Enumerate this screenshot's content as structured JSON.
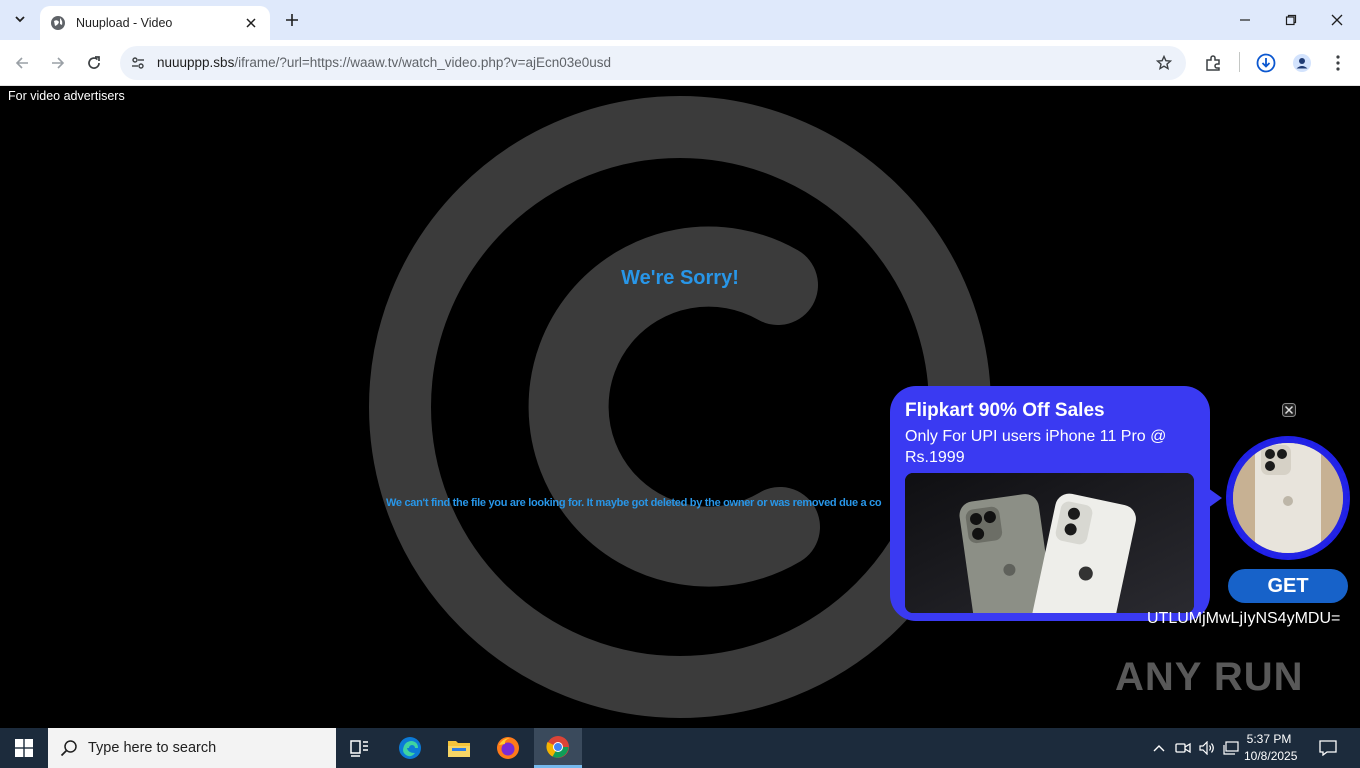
{
  "browser": {
    "tab_title": "Nuupload - Video",
    "url_host": "nuuuppp.sbs",
    "url_path": "/iframe/?url=https://waaw.tv/watch_video.php?v=ajEcn03e0usd"
  },
  "page": {
    "advertisers_link": "For video advertisers",
    "sorry_title": "We're Sorry!",
    "sorry_text": "We can't find the file you are looking for. It maybe got deleted by the owner or was removed due a co"
  },
  "ad": {
    "headline": "Flipkart 90% Off Sales",
    "subline": "Only For UPI users iPhone 11 Pro @ Rs.1999",
    "cta": "GET",
    "token": "UTLUMjMwLjIyNS4yMDU=",
    "watermark": "ANY RUN",
    "accent_color": "#3a3af2"
  },
  "taskbar": {
    "search_placeholder": "Type here to search",
    "time": "5:37 PM",
    "date": "10/8/2025"
  }
}
